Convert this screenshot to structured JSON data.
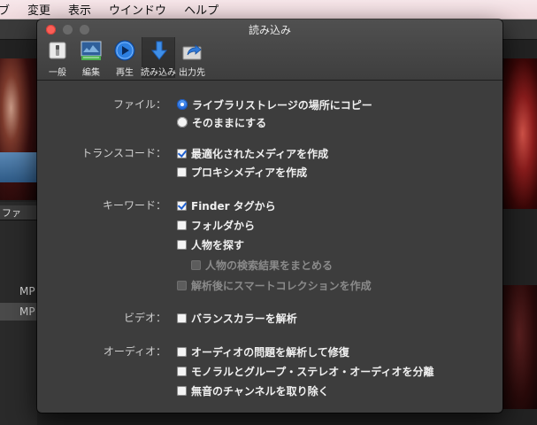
{
  "menubar": {
    "items": [
      "ブ",
      "変更",
      "表示",
      "ウインドウ",
      "ヘルプ"
    ]
  },
  "background": {
    "list_header": "ファ",
    "rows": [
      "MP",
      "MP"
    ]
  },
  "dialog": {
    "title": "読み込み",
    "toolbar": [
      {
        "label": "一般",
        "icon": "switch-icon"
      },
      {
        "label": "編集",
        "icon": "edit-icon"
      },
      {
        "label": "再生",
        "icon": "play-icon"
      },
      {
        "label": "読み込み",
        "icon": "import-icon",
        "selected": true
      },
      {
        "label": "出力先",
        "icon": "share-icon"
      }
    ],
    "sections": {
      "file": {
        "label": "ファイル：",
        "options": [
          {
            "text": "ライブラリストレージの場所にコピー",
            "selected": true
          },
          {
            "text": "そのままにする",
            "selected": false
          }
        ]
      },
      "transcode": {
        "label": "トランスコード：",
        "options": [
          {
            "text": "最適化されたメディアを作成",
            "checked": true
          },
          {
            "text": "プロキシメディアを作成",
            "checked": false
          }
        ]
      },
      "keywords": {
        "label": "キーワード：",
        "options": [
          {
            "text": "Finder タグから",
            "checked": true
          },
          {
            "text": "フォルダから",
            "checked": false
          },
          {
            "text": "人物を探す",
            "checked": false
          },
          {
            "text": "人物の検索結果をまとめる",
            "checked": false,
            "disabled": true
          },
          {
            "text": "解析後にスマートコレクションを作成",
            "checked": false,
            "disabled": true
          }
        ]
      },
      "video": {
        "label": "ビデオ：",
        "options": [
          {
            "text": "バランスカラーを解析",
            "checked": false
          }
        ]
      },
      "audio": {
        "label": "オーディオ：",
        "options": [
          {
            "text": "オーディオの問題を解析して修復",
            "checked": false
          },
          {
            "text": "モノラルとグループ・ステレオ・オーディオを分離",
            "checked": false
          },
          {
            "text": "無音のチャンネルを取り除く",
            "checked": false
          }
        ]
      }
    }
  },
  "colors": {
    "accent": "#1f64d8",
    "dialog_bg": "#3d3d3d",
    "close": "#fc5f57"
  }
}
